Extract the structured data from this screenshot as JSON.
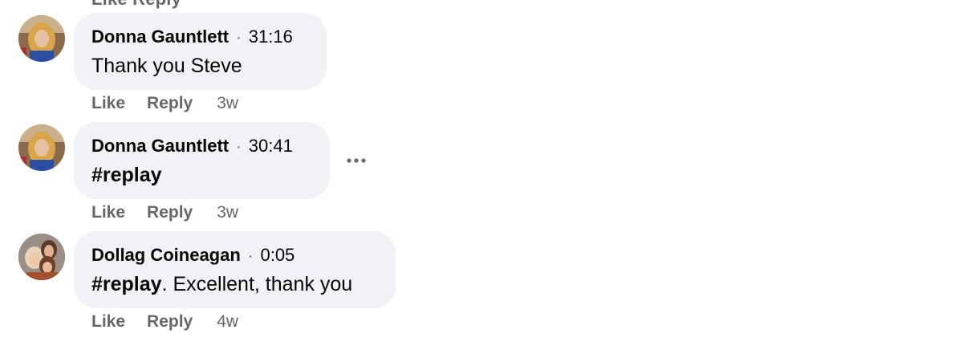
{
  "top_cut_label": "Like  Reply",
  "comments": [
    {
      "author": "Donna Gauntlett",
      "separator": "·",
      "timestamp": "31:16",
      "hashtag": "",
      "text": "Thank you Steve",
      "actions": {
        "like": "Like",
        "reply": "Reply",
        "age": "3w"
      }
    },
    {
      "author": "Donna Gauntlett",
      "separator": "·",
      "timestamp": "30:41",
      "hashtag": "#replay",
      "text": "",
      "actions": {
        "like": "Like",
        "reply": "Reply",
        "age": "3w"
      },
      "more_icon": "more-horizontal-icon"
    },
    {
      "author": "Dollag Coineagan",
      "separator": "·",
      "timestamp": "0:05",
      "hashtag": "#replay",
      "text": ". Excellent, thank you",
      "actions": {
        "like": "Like",
        "reply": "Reply",
        "age": "4w"
      }
    }
  ],
  "colors": {
    "bubble": "#f0f2f5",
    "text": "#050505",
    "secondary": "#65676b"
  }
}
